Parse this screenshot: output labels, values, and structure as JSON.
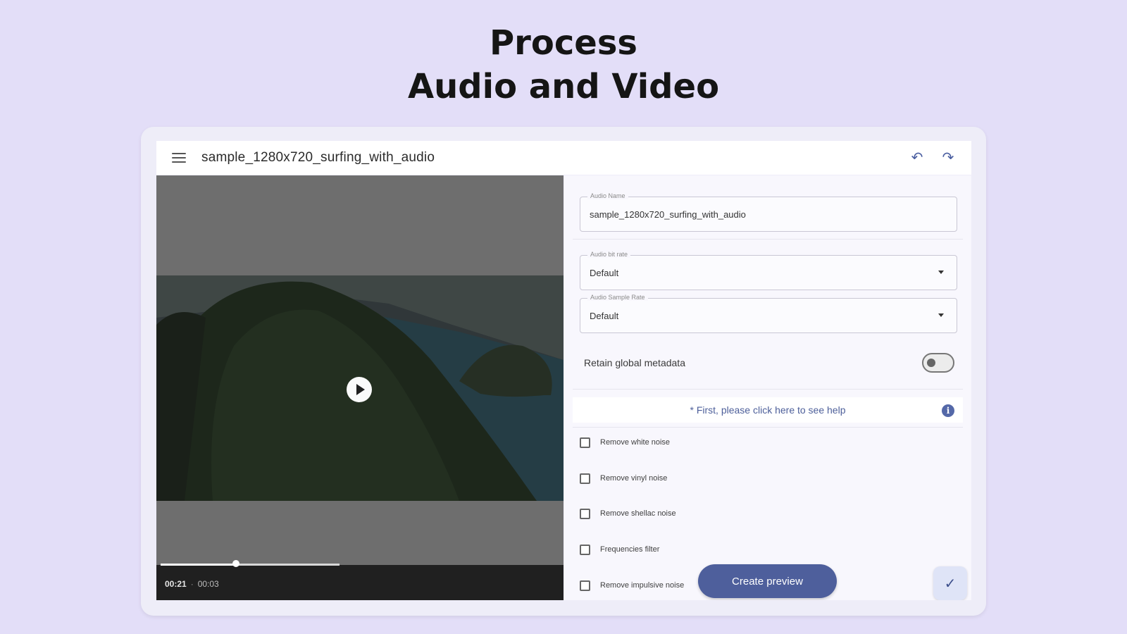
{
  "headline": {
    "line1": "Process",
    "line2": "Audio and Video"
  },
  "topbar": {
    "file_name": "sample_1280x720_surfing_with_audio"
  },
  "player": {
    "current_time": "00:21",
    "separator": "·",
    "duration": "00:03",
    "progress_fraction": 0.42
  },
  "panel": {
    "audio_name": {
      "label": "Audio Name",
      "value": "sample_1280x720_surfing_with_audio"
    },
    "bit_rate": {
      "label": "Audio bit rate",
      "value": "Default"
    },
    "sample_rate": {
      "label": "Audio Sample Rate",
      "value": "Default"
    },
    "retain_metadata": {
      "label": "Retain global metadata",
      "enabled": false
    },
    "help": {
      "text": "* First, please click here to see help",
      "icon": "info-icon"
    },
    "filters": [
      {
        "label": "Remove white noise",
        "checked": false
      },
      {
        "label": "Remove vinyl noise",
        "checked": false
      },
      {
        "label": "Remove shellac noise",
        "checked": false
      },
      {
        "label": "Frequencies filter",
        "checked": false
      },
      {
        "label": "Remove impulsive noise",
        "checked": false
      }
    ],
    "create_preview_label": "Create preview",
    "confirm_icon": "check-icon"
  },
  "colors": {
    "background": "#e3def8",
    "accent": "#4e5f9c",
    "panel": "#f8f7fd"
  }
}
